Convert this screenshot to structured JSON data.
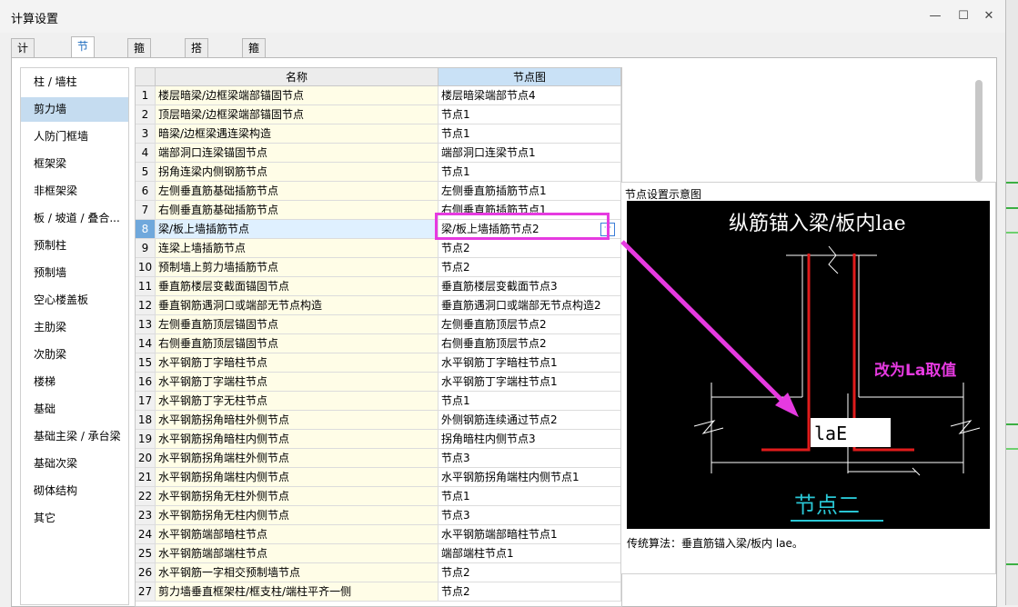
{
  "window": {
    "title": "计算设置",
    "min_glyph": "—",
    "max_glyph": "☐",
    "close_glyph": "✕"
  },
  "tabs": [
    "计算规则",
    "节点设置",
    "箍筋设置",
    "搭接设置",
    "箍筋公式"
  ],
  "active_tab": 1,
  "nav": [
    "柱 / 墙柱",
    "剪力墙",
    "人防门框墙",
    "框架梁",
    "非框架梁",
    "板 / 坡道 / 叠合...",
    "预制柱",
    "预制墙",
    "空心楼盖板",
    "主肋梁",
    "次肋梁",
    "楼梯",
    "基础",
    "基础主梁 / 承台梁",
    "基础次梁",
    "砌体结构",
    "其它"
  ],
  "active_nav": 1,
  "grid": {
    "headers": {
      "name": "名称",
      "node": "节点图"
    },
    "rows": [
      {
        "num": "1",
        "name": "楼层暗梁/边框梁端部锚固节点",
        "value": "楼层暗梁端部节点4"
      },
      {
        "num": "2",
        "name": "顶层暗梁/边框梁端部锚固节点",
        "value": "节点1"
      },
      {
        "num": "3",
        "name": "暗梁/边框梁遇连梁构造",
        "value": "节点1"
      },
      {
        "num": "4",
        "name": "端部洞口连梁锚固节点",
        "value": "端部洞口连梁节点1"
      },
      {
        "num": "5",
        "name": "拐角连梁内侧钢筋节点",
        "value": "节点1"
      },
      {
        "num": "6",
        "name": "左侧垂直筋基础插筋节点",
        "value": "左侧垂直筋插筋节点1"
      },
      {
        "num": "7",
        "name": "右侧垂直筋基础插筋节点",
        "value": "右侧垂直筋插筋节点1"
      },
      {
        "num": "8",
        "name": "梁/板上墙插筋节点",
        "value": "梁/板上墙插筋节点2"
      },
      {
        "num": "9",
        "name": "连梁上墙插筋节点",
        "value": "节点2"
      },
      {
        "num": "10",
        "name": "预制墙上剪力墙插筋节点",
        "value": "节点2"
      },
      {
        "num": "11",
        "name": "垂直筋楼层变截面锚固节点",
        "value": "垂直筋楼层变截面节点3"
      },
      {
        "num": "12",
        "name": "垂直钢筋遇洞口或端部无节点构造",
        "value": "垂直筋遇洞口或端部无节点构造2"
      },
      {
        "num": "13",
        "name": "左侧垂直筋顶层锚固节点",
        "value": "左侧垂直筋顶层节点2"
      },
      {
        "num": "14",
        "name": "右侧垂直筋顶层锚固节点",
        "value": "右侧垂直筋顶层节点2"
      },
      {
        "num": "15",
        "name": "水平钢筋丁字暗柱节点",
        "value": "水平钢筋丁字暗柱节点1"
      },
      {
        "num": "16",
        "name": "水平钢筋丁字端柱节点",
        "value": "水平钢筋丁字端柱节点1"
      },
      {
        "num": "17",
        "name": "水平钢筋丁字无柱节点",
        "value": "节点1"
      },
      {
        "num": "18",
        "name": "水平钢筋拐角暗柱外侧节点",
        "value": "外侧钢筋连续通过节点2"
      },
      {
        "num": "19",
        "name": "水平钢筋拐角暗柱内侧节点",
        "value": "拐角暗柱内侧节点3"
      },
      {
        "num": "20",
        "name": "水平钢筋拐角端柱外侧节点",
        "value": "节点3"
      },
      {
        "num": "21",
        "name": "水平钢筋拐角端柱内侧节点",
        "value": "水平钢筋拐角端柱内侧节点1"
      },
      {
        "num": "22",
        "name": "水平钢筋拐角无柱外侧节点",
        "value": "节点1"
      },
      {
        "num": "23",
        "name": "水平钢筋拐角无柱内侧节点",
        "value": "节点3"
      },
      {
        "num": "24",
        "name": "水平钢筋端部暗柱节点",
        "value": "水平钢筋端部暗柱节点1"
      },
      {
        "num": "25",
        "name": "水平钢筋端部端柱节点",
        "value": "端部端柱节点1"
      },
      {
        "num": "26",
        "name": "水平钢筋一字相交预制墙节点",
        "value": "节点2"
      },
      {
        "num": "27",
        "name": "剪力墙垂直框架柱/框支柱/端柱平齐一侧",
        "value": "节点2"
      }
    ],
    "selected_row": 8
  },
  "diagram": {
    "title": "节点设置示意图",
    "heading": "纵筋锚入梁/板内lae",
    "label_lae": "laE",
    "note": "改为La取值",
    "node_name": "节点二",
    "caption": "传统算法：垂直筋锚入梁/板内 lae。",
    "colors": {
      "rebar": "#e01b1b",
      "annotation": "#e63ae0",
      "node_name": "#29c6d4",
      "lines": "#ffffff"
    }
  }
}
